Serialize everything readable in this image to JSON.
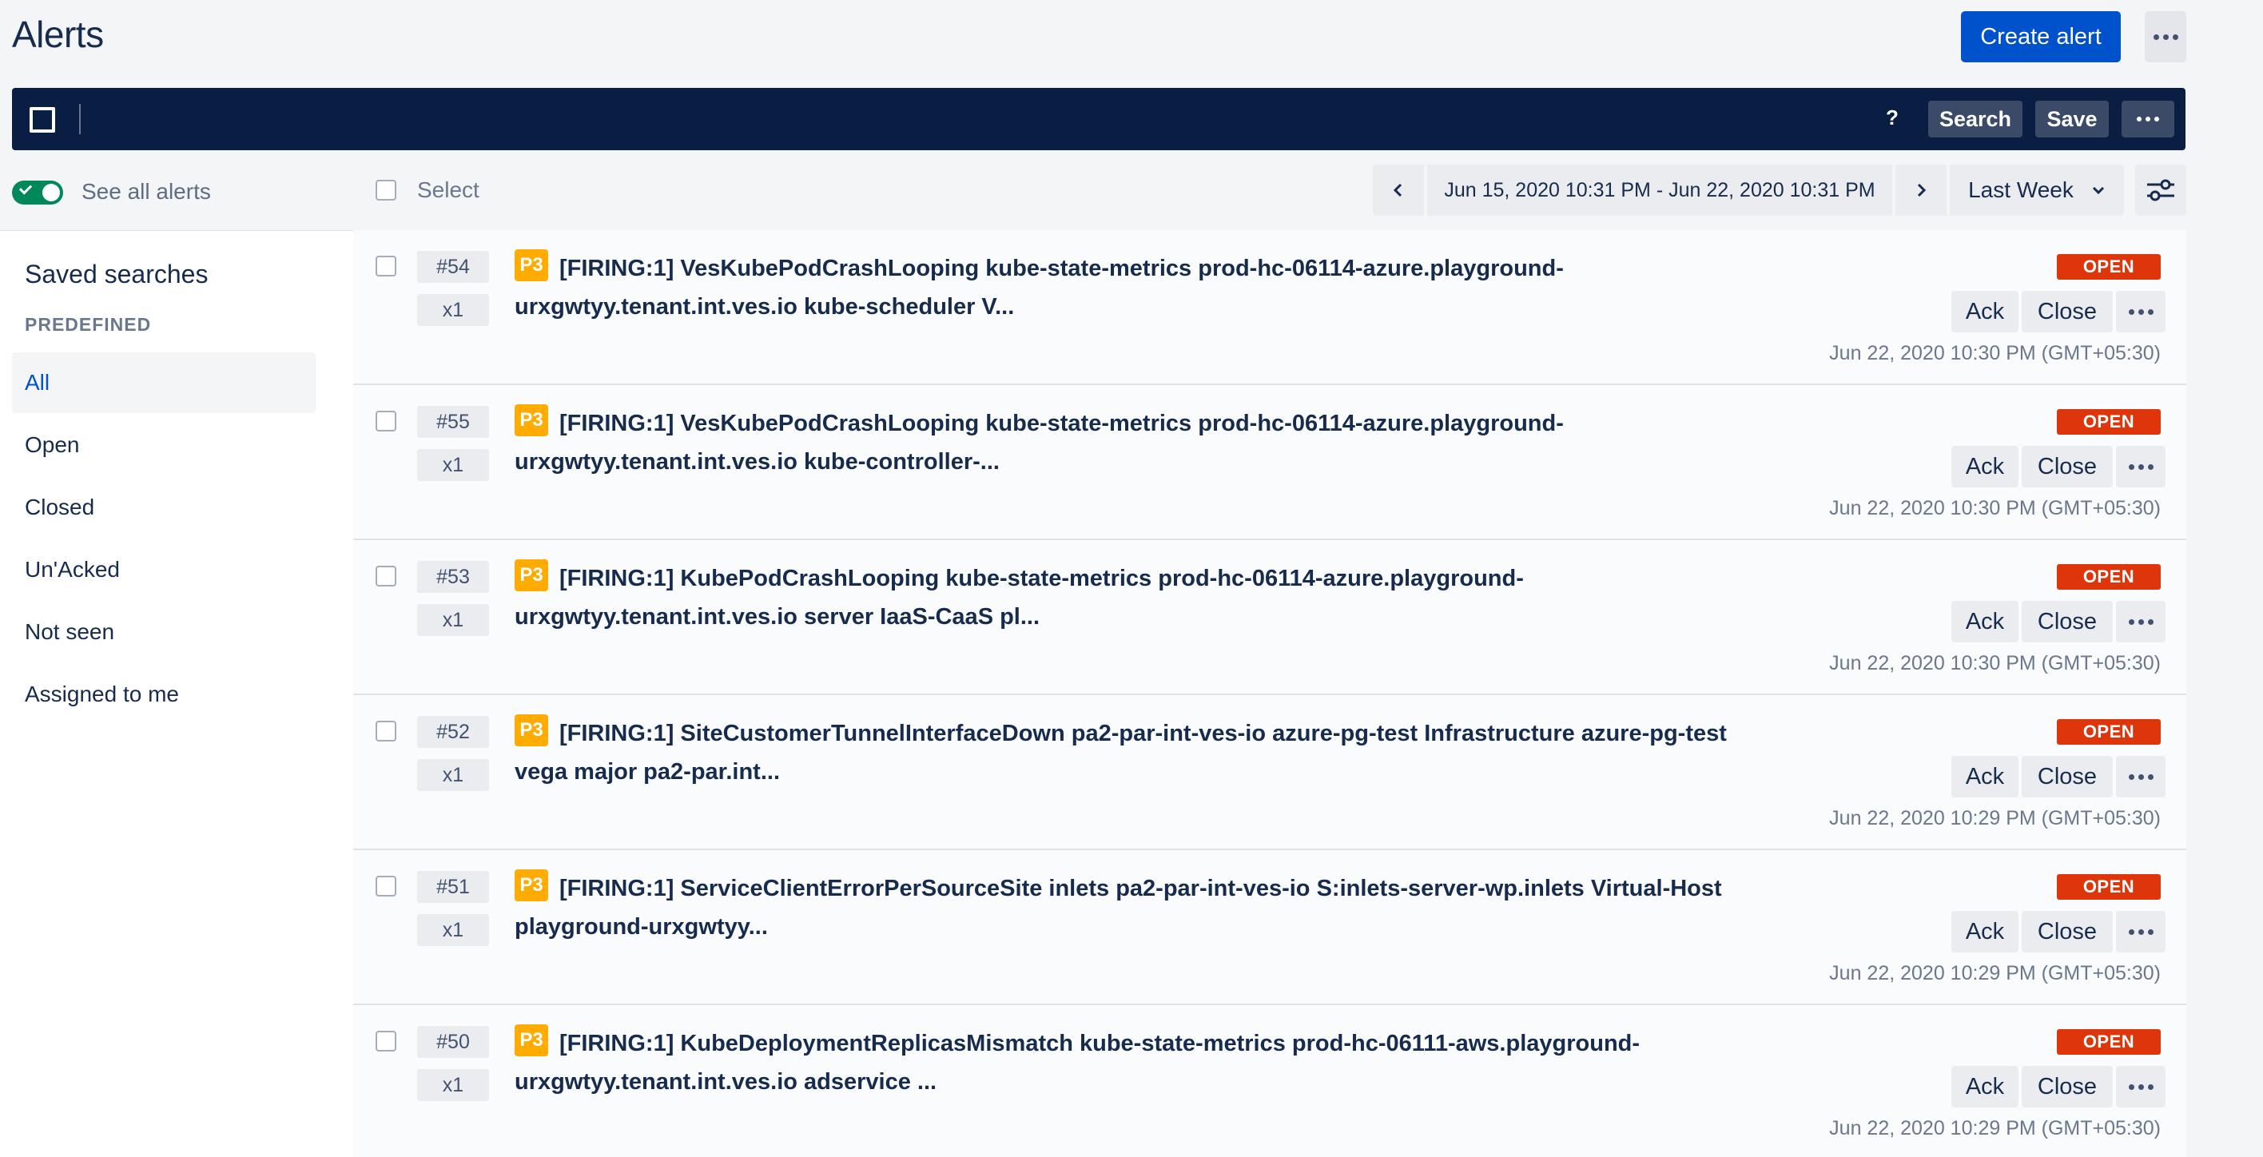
{
  "header": {
    "title": "Alerts",
    "create_label": "Create alert",
    "more_icon": "more-horizontal-icon"
  },
  "search_bar": {
    "help_label": "?",
    "search_label": "Search",
    "save_label": "Save"
  },
  "filters": {
    "toggle_on": true,
    "see_all_label": "See all alerts",
    "select_label": "Select",
    "date_range": "Jun 15, 2020 10:31 PM - Jun 22, 2020 10:31 PM",
    "period": "Last Week"
  },
  "sidebar": {
    "title": "Saved searches",
    "section_label": "PREDEFINED",
    "items": [
      {
        "label": "All",
        "active": true
      },
      {
        "label": "Open",
        "active": false
      },
      {
        "label": "Closed",
        "active": false
      },
      {
        "label": "Un'Acked",
        "active": false
      },
      {
        "label": "Not seen",
        "active": false
      },
      {
        "label": "Assigned to me",
        "active": false
      }
    ]
  },
  "alerts": [
    {
      "num": "#54",
      "count": "x1",
      "priority": "P3",
      "text": "[FIRING:1] VesKubePodCrashLooping kube-state-metrics prod-hc-06114-azure.playground-urxgwtyy.tenant.int.ves.io kube-scheduler V...",
      "status": "OPEN",
      "ack": "Ack",
      "close": "Close",
      "time": "Jun 22, 2020 10:30 PM (GMT+05:30)"
    },
    {
      "num": "#55",
      "count": "x1",
      "priority": "P3",
      "text": "[FIRING:1] VesKubePodCrashLooping kube-state-metrics prod-hc-06114-azure.playground-urxgwtyy.tenant.int.ves.io kube-controller-...",
      "status": "OPEN",
      "ack": "Ack",
      "close": "Close",
      "time": "Jun 22, 2020 10:30 PM (GMT+05:30)"
    },
    {
      "num": "#53",
      "count": "x1",
      "priority": "P3",
      "text": "[FIRING:1] KubePodCrashLooping kube-state-metrics prod-hc-06114-azure.playground-urxgwtyy.tenant.int.ves.io server IaaS-CaaS pl...",
      "status": "OPEN",
      "ack": "Ack",
      "close": "Close",
      "time": "Jun 22, 2020 10:30 PM (GMT+05:30)"
    },
    {
      "num": "#52",
      "count": "x1",
      "priority": "P3",
      "text": "[FIRING:1] SiteCustomerTunnelInterfaceDown pa2-par-int-ves-io azure-pg-test Infrastructure azure-pg-test vega major pa2-par.int...",
      "status": "OPEN",
      "ack": "Ack",
      "close": "Close",
      "time": "Jun 22, 2020 10:29 PM (GMT+05:30)"
    },
    {
      "num": "#51",
      "count": "x1",
      "priority": "P3",
      "text": "[FIRING:1] ServiceClientErrorPerSourceSite inlets pa2-par-int-ves-io S:inlets-server-wp.inlets Virtual-Host playground-urxgwtyy...",
      "status": "OPEN",
      "ack": "Ack",
      "close": "Close",
      "time": "Jun 22, 2020 10:29 PM (GMT+05:30)"
    },
    {
      "num": "#50",
      "count": "x1",
      "priority": "P3",
      "text": "[FIRING:1] KubeDeploymentReplicasMismatch kube-state-metrics prod-hc-06111-aws.playground-urxgwtyy.tenant.int.ves.io adservice ...",
      "status": "OPEN",
      "ack": "Ack",
      "close": "Close",
      "time": "Jun 22, 2020 10:29 PM (GMT+05:30)"
    }
  ]
}
